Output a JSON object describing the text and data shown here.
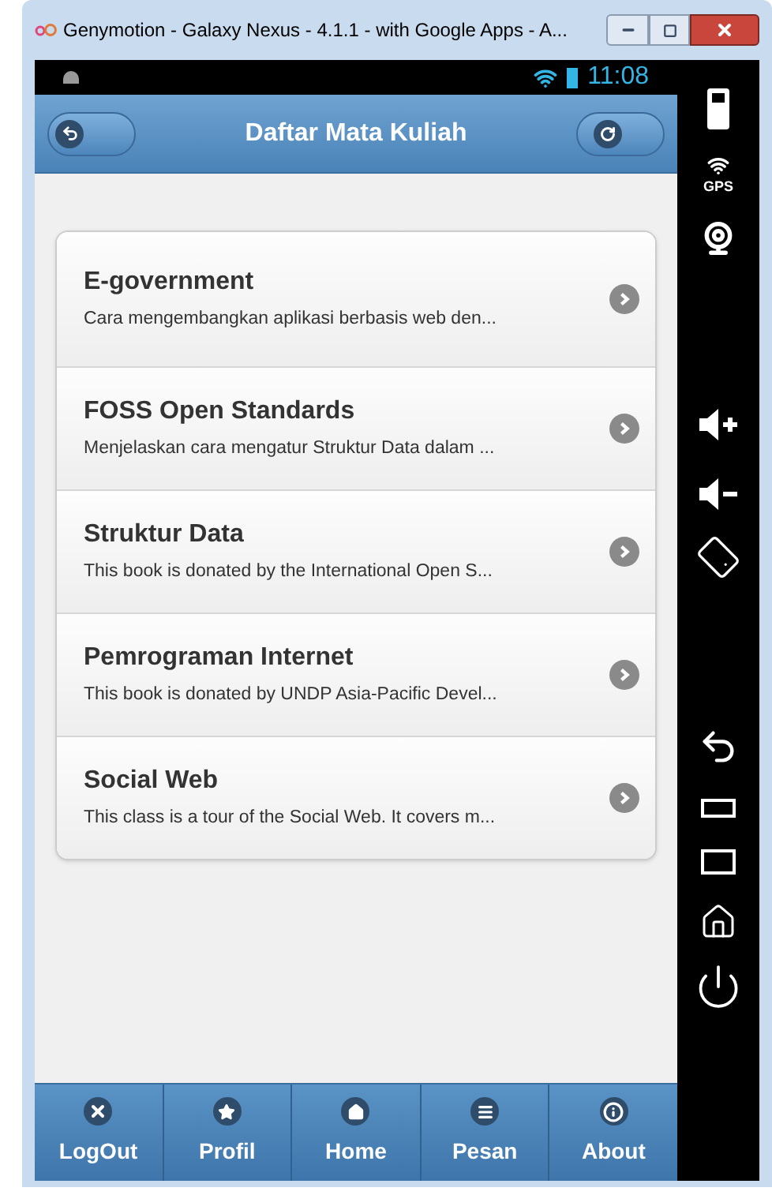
{
  "window": {
    "title": "Genymotion - Galaxy Nexus - 4.1.1 - with Google Apps - A..."
  },
  "status_bar": {
    "time": "11:08"
  },
  "header": {
    "title": "Daftar Mata Kuliah"
  },
  "courses": [
    {
      "title": "E-government",
      "description": "Cara mengembangkan aplikasi berbasis web den..."
    },
    {
      "title": "FOSS Open Standards",
      "description": "Menjelaskan cara mengatur Struktur Data dalam ..."
    },
    {
      "title": "Struktur Data",
      "description": "This book is donated by the International Open S..."
    },
    {
      "title": "Pemrograman Internet",
      "description": "This book is donated by UNDP Asia-Pacific Devel..."
    },
    {
      "title": "Social Web",
      "description": "This class is a tour of the Social Web. It covers m..."
    }
  ],
  "footer": [
    {
      "label": "LogOut",
      "kind": "close"
    },
    {
      "label": "Profil",
      "kind": "star"
    },
    {
      "label": "Home",
      "kind": "home"
    },
    {
      "label": "Pesan",
      "kind": "list"
    },
    {
      "label": "About",
      "kind": "info"
    }
  ],
  "side_panel": {
    "gps_label": "GPS"
  }
}
